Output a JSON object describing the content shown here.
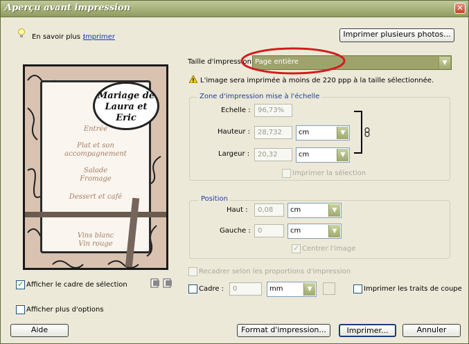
{
  "window": {
    "title": "Aperçu avant impression",
    "close_glyph": "✕"
  },
  "help": {
    "prefix": "En savoir plus :",
    "link": "Imprimer"
  },
  "buttons": {
    "print_multiple": "Imprimer plusieurs photos...",
    "help": "Aide",
    "page_setup": "Format d'impression...",
    "print": "Imprimer...",
    "cancel": "Annuler"
  },
  "print_size": {
    "label": "Taille d'impression :",
    "value": "Page entière"
  },
  "warning": "L'image sera imprimée à moins de 220 ppp à la taille sélectionnée.",
  "scaled_area": {
    "legend": "Zone d'impression mise à l'échelle",
    "scale_label": "Echelle :",
    "scale_value": "96,73%",
    "height_label": "Hauteur :",
    "height_value": "28,732",
    "height_unit": "cm",
    "width_label": "Largeur :",
    "width_value": "20,32",
    "width_unit": "cm",
    "print_selection": "Imprimer la sélection"
  },
  "position": {
    "legend": "Position",
    "top_label": "Haut :",
    "top_value": "0,08",
    "top_unit": "cm",
    "left_label": "Gauche :",
    "left_value": "0",
    "left_unit": "cm",
    "center_image": "Centrer l'image"
  },
  "options": {
    "reframe": "Recadrer selon les proportions d'impression",
    "frame_label": "Cadre :",
    "frame_value": "0",
    "frame_unit": "mm",
    "crop_marks": "Imprimer les traits de coupe",
    "show_bounding_box": "Afficher le cadre de sélection",
    "show_more_options": "Afficher plus d'options"
  },
  "preview_card": {
    "title_line1": "Mariage de",
    "title_line2": "Laura et Eric",
    "menu": [
      "Entrée",
      "Plat et son",
      "accompagnement",
      "Salade",
      "Fromage",
      "Dessert et café",
      "Vins blanc",
      "Vin rouge"
    ]
  },
  "colors": {
    "title_bar": "#a4ae76",
    "highlight_oval": "#d41b1b",
    "size_field": "#9ea36c"
  }
}
